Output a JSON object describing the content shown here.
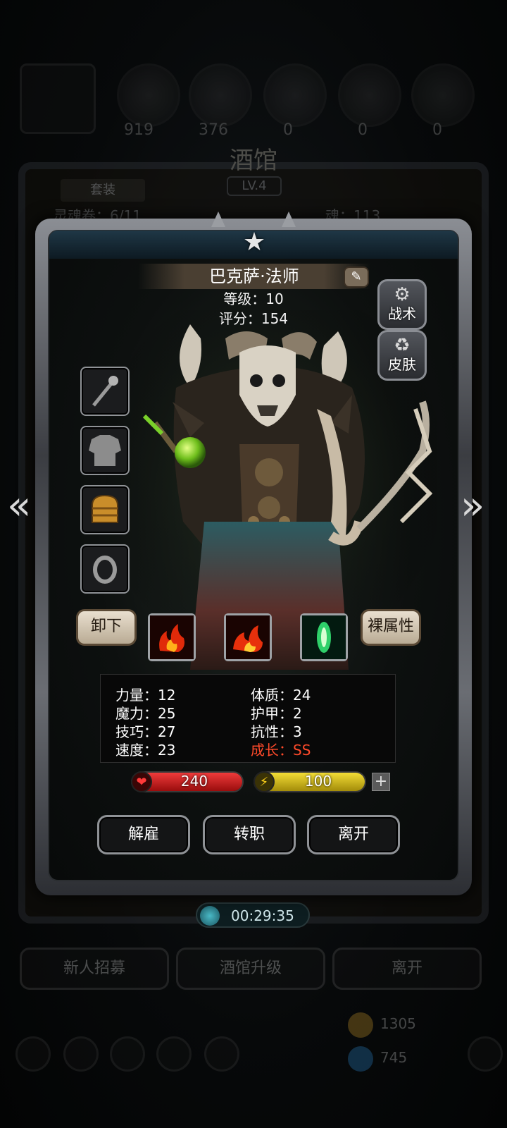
{
  "background": {
    "resources": [
      "919",
      "376",
      "0",
      "0",
      "0"
    ],
    "title": "酒馆",
    "level": "LV.4",
    "tab": "套装",
    "left_row": "灵魂卷：6/11",
    "right_row": "魂：113",
    "buttons": [
      "新人招募",
      "酒馆升级",
      "离开"
    ],
    "gold": "1305",
    "gems": "745"
  },
  "timer": "00:29:35",
  "character": {
    "name": "巴克萨·法师",
    "level_line": "等级：10",
    "score_line": "评分：154"
  },
  "side_buttons": {
    "tactics": "战术",
    "skin": "皮肤"
  },
  "equipment": {
    "slots": [
      "staff",
      "armor",
      "helmet",
      "ring"
    ],
    "unequip": "卸下",
    "bare_attributes": "裸属性"
  },
  "skills": [
    "fire-skill",
    "fire-skill",
    "poison-skill"
  ],
  "attributes": {
    "left": [
      "力量：12",
      "魔力：25",
      "技巧：27",
      "速度：23"
    ],
    "right": [
      "体质：24",
      "护甲：2",
      "抗性：3"
    ],
    "growth": "成长：SS"
  },
  "bars": {
    "hp": "240",
    "energy": "100",
    "plus": "+"
  },
  "actions": {
    "dismiss": "解雇",
    "transfer": "转职",
    "leave": "离开"
  },
  "colors": {
    "hp": "#c81b1b",
    "energy": "#d9c21a",
    "growth": "#ff4a2a"
  }
}
